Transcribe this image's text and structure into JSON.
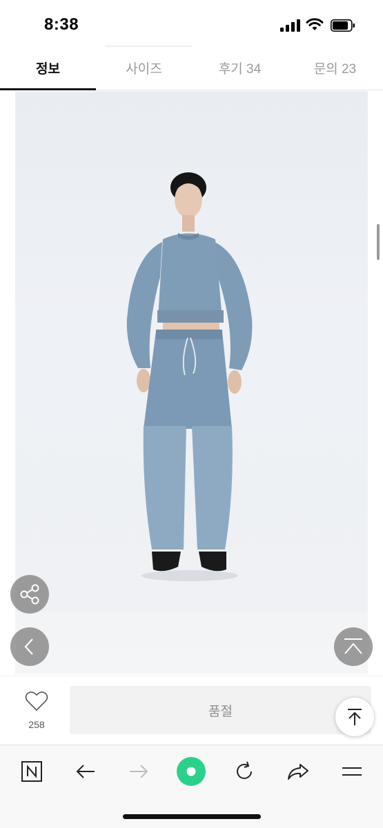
{
  "status_bar": {
    "time": "8:38"
  },
  "tabs": [
    {
      "label": "정보",
      "active": true
    },
    {
      "label": "사이즈",
      "active": false
    },
    {
      "label": "후기 34",
      "active": false
    },
    {
      "label": "문의 23",
      "active": false
    }
  ],
  "product_image": {
    "description_icon": "model-photo"
  },
  "floating_buttons": {
    "share_icon": "share-icon",
    "prev_icon": "chevron-left-icon",
    "scroll_top_icon": "chevron-up-icon"
  },
  "purchase_bar": {
    "like_count": "258",
    "action_label": "품절"
  },
  "browser_toolbar": {
    "items": [
      "naver-n-icon",
      "back-arrow-icon",
      "forward-arrow-icon",
      "green-home-icon",
      "refresh-icon",
      "share-arrow-icon",
      "menu-icon"
    ]
  },
  "colors": {
    "accent_green": "#2bd18a",
    "active_tab": "#111111",
    "inactive_tab": "#9a9a9a",
    "denim": "#7f9cb6"
  }
}
